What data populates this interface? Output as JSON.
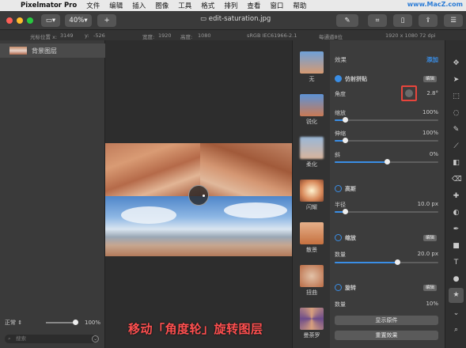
{
  "menubar": {
    "apple": "",
    "app": "Pixelmator Pro",
    "items": [
      "文件",
      "编辑",
      "插入",
      "图像",
      "工具",
      "格式",
      "排列",
      "查看",
      "窗口",
      "帮助"
    ],
    "watermark": "www.MacZ.com"
  },
  "titlebar": {
    "zoom": "40%",
    "add": "+",
    "doc": "edit-saturation.jpg"
  },
  "infobar": {
    "cursor_x_label": "光标位置 x:",
    "cursor_x": "3149",
    "cursor_y_label": "y:",
    "cursor_y": "-526",
    "width_label": "宽度:",
    "width": "1920",
    "height_label": "高度:",
    "height": "1080",
    "profile": "sRGB IEC61966-2.1",
    "depth": "每通道8位",
    "size": "1920 x 1080 72 dpi"
  },
  "layers": {
    "name": "背景图层",
    "blend": "正常",
    "opacity": "100%",
    "search": "搜索"
  },
  "effects": [
    {
      "label": "无"
    },
    {
      "label": "锐化"
    },
    {
      "label": "柔化"
    },
    {
      "label": "闪耀"
    },
    {
      "label": "散景"
    },
    {
      "label": "扭曲"
    },
    {
      "label": "曼荼罗"
    }
  ],
  "settings": {
    "effects_label": "效果",
    "add": "添加",
    "tile": {
      "title": "仿射拼贴",
      "badge": "编辑",
      "angle": {
        "label": "角度",
        "value": "2.8°"
      },
      "scale": {
        "label": "缩放",
        "value": "100%",
        "level": 0.1
      },
      "stretch": {
        "label": "伸缩",
        "value": "100%",
        "level": 0.1
      },
      "skew": {
        "label": "斜",
        "value": "0%",
        "level": 0.5
      }
    },
    "blur": {
      "title": "高斯",
      "radius": {
        "label": "半径",
        "value": "10.0 px",
        "level": 0.1
      }
    },
    "zoom": {
      "title": "缩放",
      "badge": "编辑",
      "amount": {
        "label": "数量",
        "value": "20.0 px",
        "level": 0.6
      }
    },
    "spin": {
      "title": "旋转",
      "badge": "编辑",
      "amount": {
        "label": "数量",
        "value": "10%"
      }
    },
    "show_original": "显示原件",
    "reset": "重置效果"
  },
  "caption": "移动「角度轮」旋转图层",
  "colors": {
    "accent": "#3a8ee6",
    "highlight": "#e8453c",
    "caption": "#ff5050"
  }
}
